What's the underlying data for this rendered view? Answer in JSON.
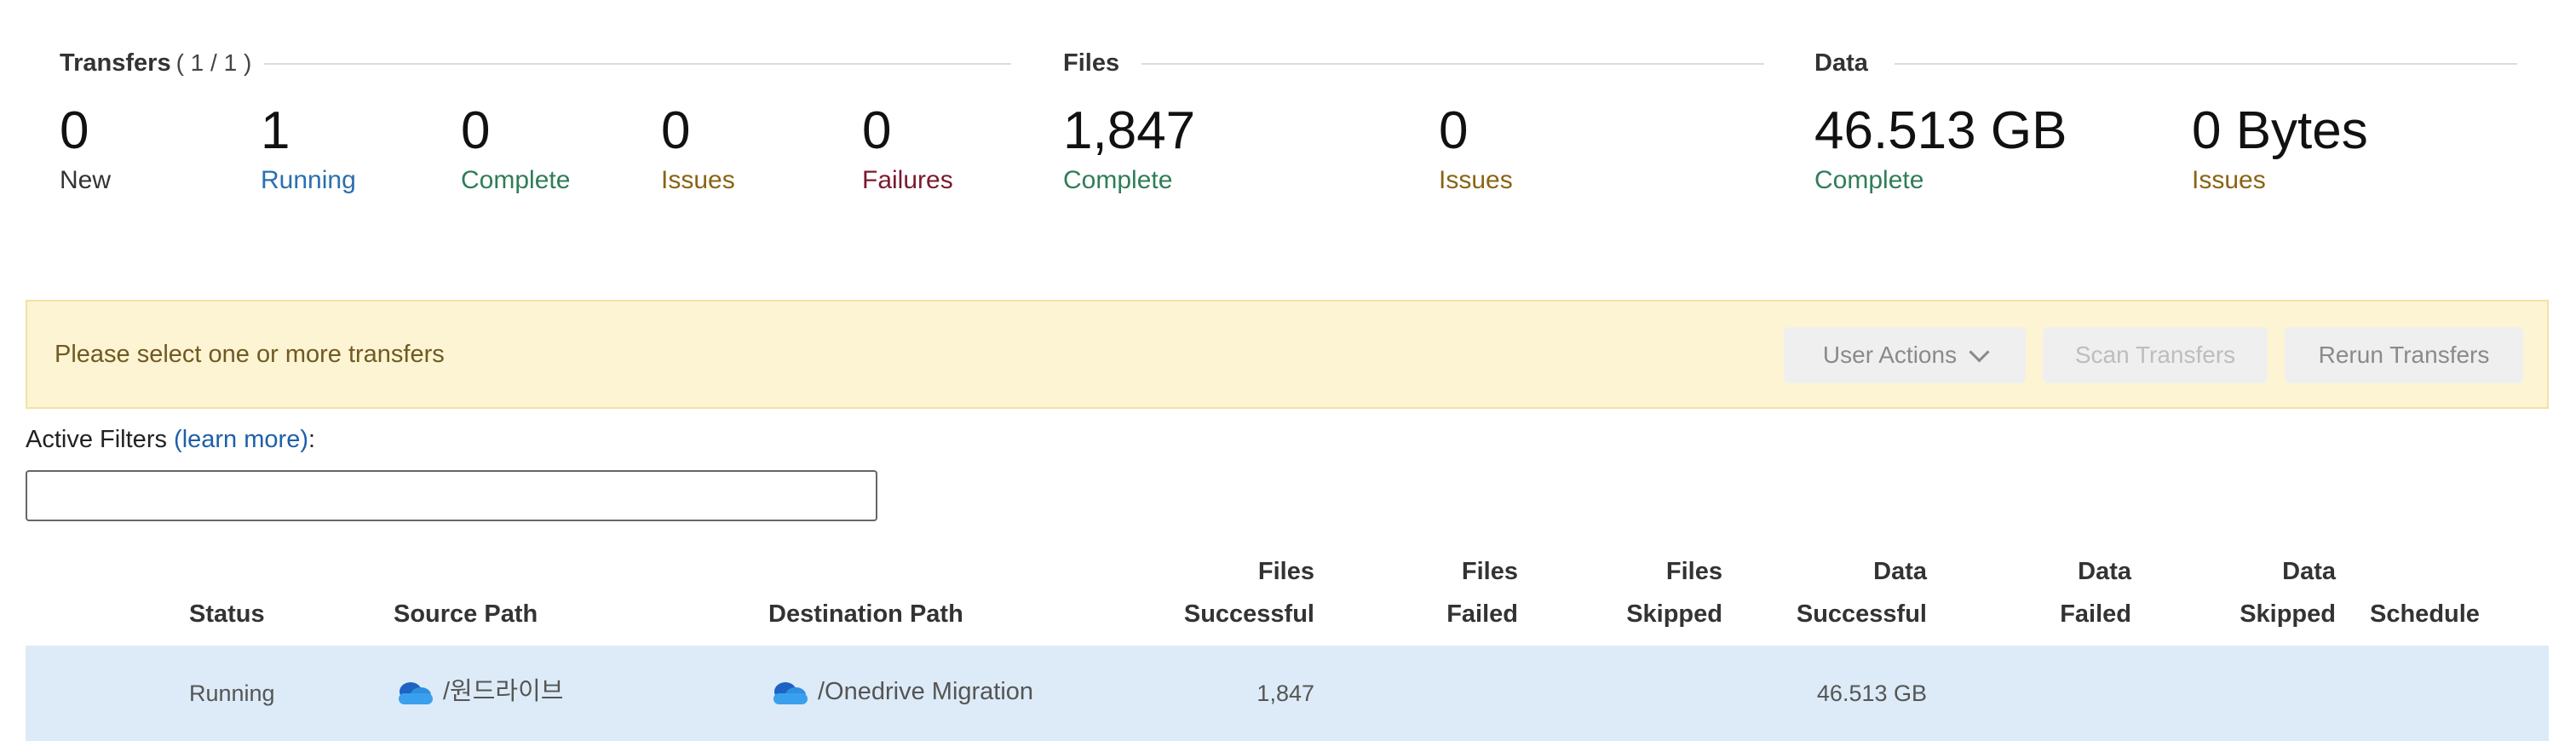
{
  "summary": {
    "transfers": {
      "title": "Transfers",
      "count": "( 1 / 1 )",
      "stats": [
        {
          "value": "0",
          "label": "New"
        },
        {
          "value": "1",
          "label": "Running"
        },
        {
          "value": "0",
          "label": "Complete"
        },
        {
          "value": "0",
          "label": "Issues"
        },
        {
          "value": "0",
          "label": "Failures"
        }
      ]
    },
    "files": {
      "title": "Files",
      "stats": [
        {
          "value": "1,847",
          "label": "Complete"
        },
        {
          "value": "0",
          "label": "Issues"
        }
      ]
    },
    "data": {
      "title": "Data",
      "stats": [
        {
          "value": "46.513 GB",
          "label": "Complete"
        },
        {
          "value": "0 Bytes",
          "label": "Issues"
        }
      ]
    }
  },
  "banner": {
    "message": "Please select one or more transfers",
    "user_actions": "User Actions",
    "scan_transfers": "Scan Transfers",
    "rerun_transfers": "Rerun Transfers"
  },
  "filters": {
    "label": "Active Filters",
    "link": "(learn more)",
    "suffix": ":",
    "value": "",
    "placeholder": ""
  },
  "table": {
    "headers": {
      "status": "Status",
      "source_path": "Source Path",
      "destination_path": "Destination Path",
      "files_successful": [
        "Files",
        "Successful"
      ],
      "files_failed": [
        "Files",
        "Failed"
      ],
      "files_skipped": [
        "Files",
        "Skipped"
      ],
      "data_successful": [
        "Data",
        "Successful"
      ],
      "data_failed": [
        "Data",
        "Failed"
      ],
      "data_skipped": [
        "Data",
        "Skipped"
      ],
      "schedule": "Schedule"
    },
    "rows": [
      {
        "status": "Running",
        "source_icon": "onedrive-cloud-icon",
        "source_path": "/원드라이브",
        "destination_icon": "onedrive-cloud-icon",
        "destination_path": "/Onedrive Migration",
        "files_successful": "1,847",
        "files_failed": "",
        "files_skipped": "",
        "data_successful": "46.513 GB",
        "data_failed": "",
        "data_skipped": "",
        "schedule": ""
      }
    ]
  },
  "colors": {
    "running": "#2a6fb0",
    "complete": "#2f7d57",
    "issues": "#8a6414",
    "failures": "#7a1a2e",
    "banner_bg": "#fcf4d3",
    "row_selected_bg": "#dcebf7",
    "link": "#1f5fa8"
  }
}
